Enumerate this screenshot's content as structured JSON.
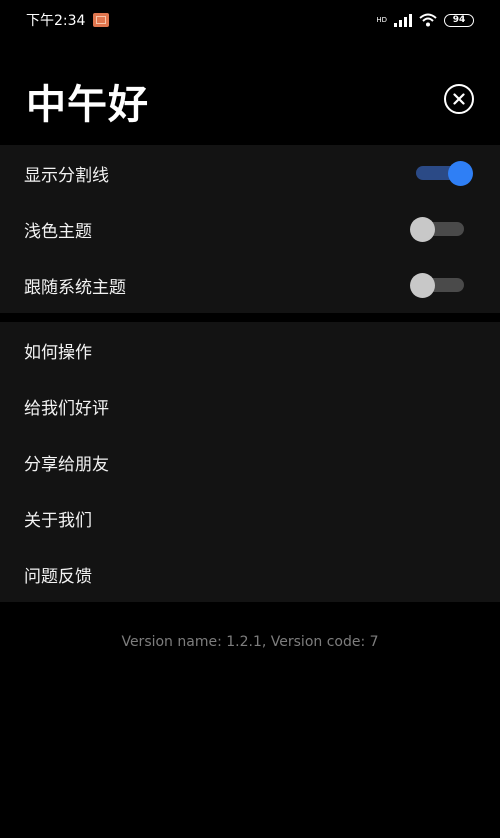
{
  "status_bar": {
    "time": "下午2:34",
    "network_label": "HD",
    "battery": "94"
  },
  "header": {
    "greeting": "中午好"
  },
  "settings": {
    "items": [
      {
        "label": "显示分割线",
        "enabled": true
      },
      {
        "label": "浅色主题",
        "enabled": false
      },
      {
        "label": "跟随系统主题",
        "enabled": false
      }
    ]
  },
  "links": {
    "items": [
      {
        "label": "如何操作"
      },
      {
        "label": "给我们好评"
      },
      {
        "label": "分享给朋友"
      },
      {
        "label": "关于我们"
      },
      {
        "label": "问题反馈"
      }
    ]
  },
  "footer": {
    "version": "Version name: 1.2.1, Version code: 7"
  },
  "colors": {
    "background": "#000000",
    "section": "#131313",
    "toggle_on": "#2f7ff5",
    "toggle_off_knob": "#c8c8c8"
  }
}
